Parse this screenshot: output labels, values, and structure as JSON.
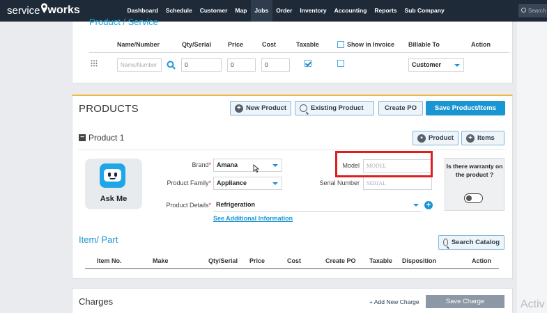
{
  "nav": {
    "logo_a": "service",
    "logo_b": "works",
    "items": [
      "Dashboard",
      "Schedule",
      "Customer",
      "Map",
      "Jobs",
      "Order",
      "Inventory",
      "Accounting",
      "Reports",
      "Sub Company"
    ],
    "active": "Jobs",
    "search_placeholder": "Search"
  },
  "product_service": {
    "section_title_cut": "Product / Service",
    "headers": {
      "name_number": "Name/Number",
      "qty_serial": "Qty/Serial",
      "price": "Price",
      "cost": "Cost",
      "taxable": "Taxable",
      "show_in_invoice": "Show in Invoice",
      "billable_to": "Billable To",
      "action": "Action"
    },
    "row": {
      "name_placeholder": "Name/Number",
      "qty": "0",
      "price": "0",
      "cost": "0",
      "taxable": true,
      "show_in_invoice": false,
      "billable_to": "Customer"
    }
  },
  "products": {
    "title": "PRODUCTS",
    "new_product": "New Product",
    "existing_product": "Existing Product",
    "create_po": "Create PO",
    "save": "Save Product/Items",
    "product_label": "Product 1",
    "product_btn": "Product",
    "items_btn": "Items",
    "ask_me": "Ask Me",
    "brand_label": "Brand",
    "brand_value": "Amana",
    "family_label": "Product Family",
    "family_value": "Appliance",
    "details_label": "Product Details",
    "details_value": "Refrigeration",
    "model_label": "Model",
    "model_placeholder": "MODEL",
    "serial_label": "Serial Number",
    "serial_placeholder": "SERIAL",
    "warranty_q": "Is there warranty on the product ?",
    "warranty_on": false,
    "see_more": "See Additional Information",
    "item_part_title": "Item/ Part",
    "search_catalog": "Search Catalog",
    "item_headers": [
      "Item No.",
      "Make",
      "Qty/Serial",
      "Price",
      "Cost",
      "Create PO",
      "Taxable",
      "Disposition",
      "Action"
    ]
  },
  "charges": {
    "title": "Charges",
    "add": "+ Add New Charge",
    "save": "Save Charge"
  },
  "watermark": "Activ",
  "colors": {
    "topbar": "#1f2a38",
    "accent": "#1a95d3",
    "highlight": "#e21d1d",
    "card_top_border": "#f0b73c"
  }
}
